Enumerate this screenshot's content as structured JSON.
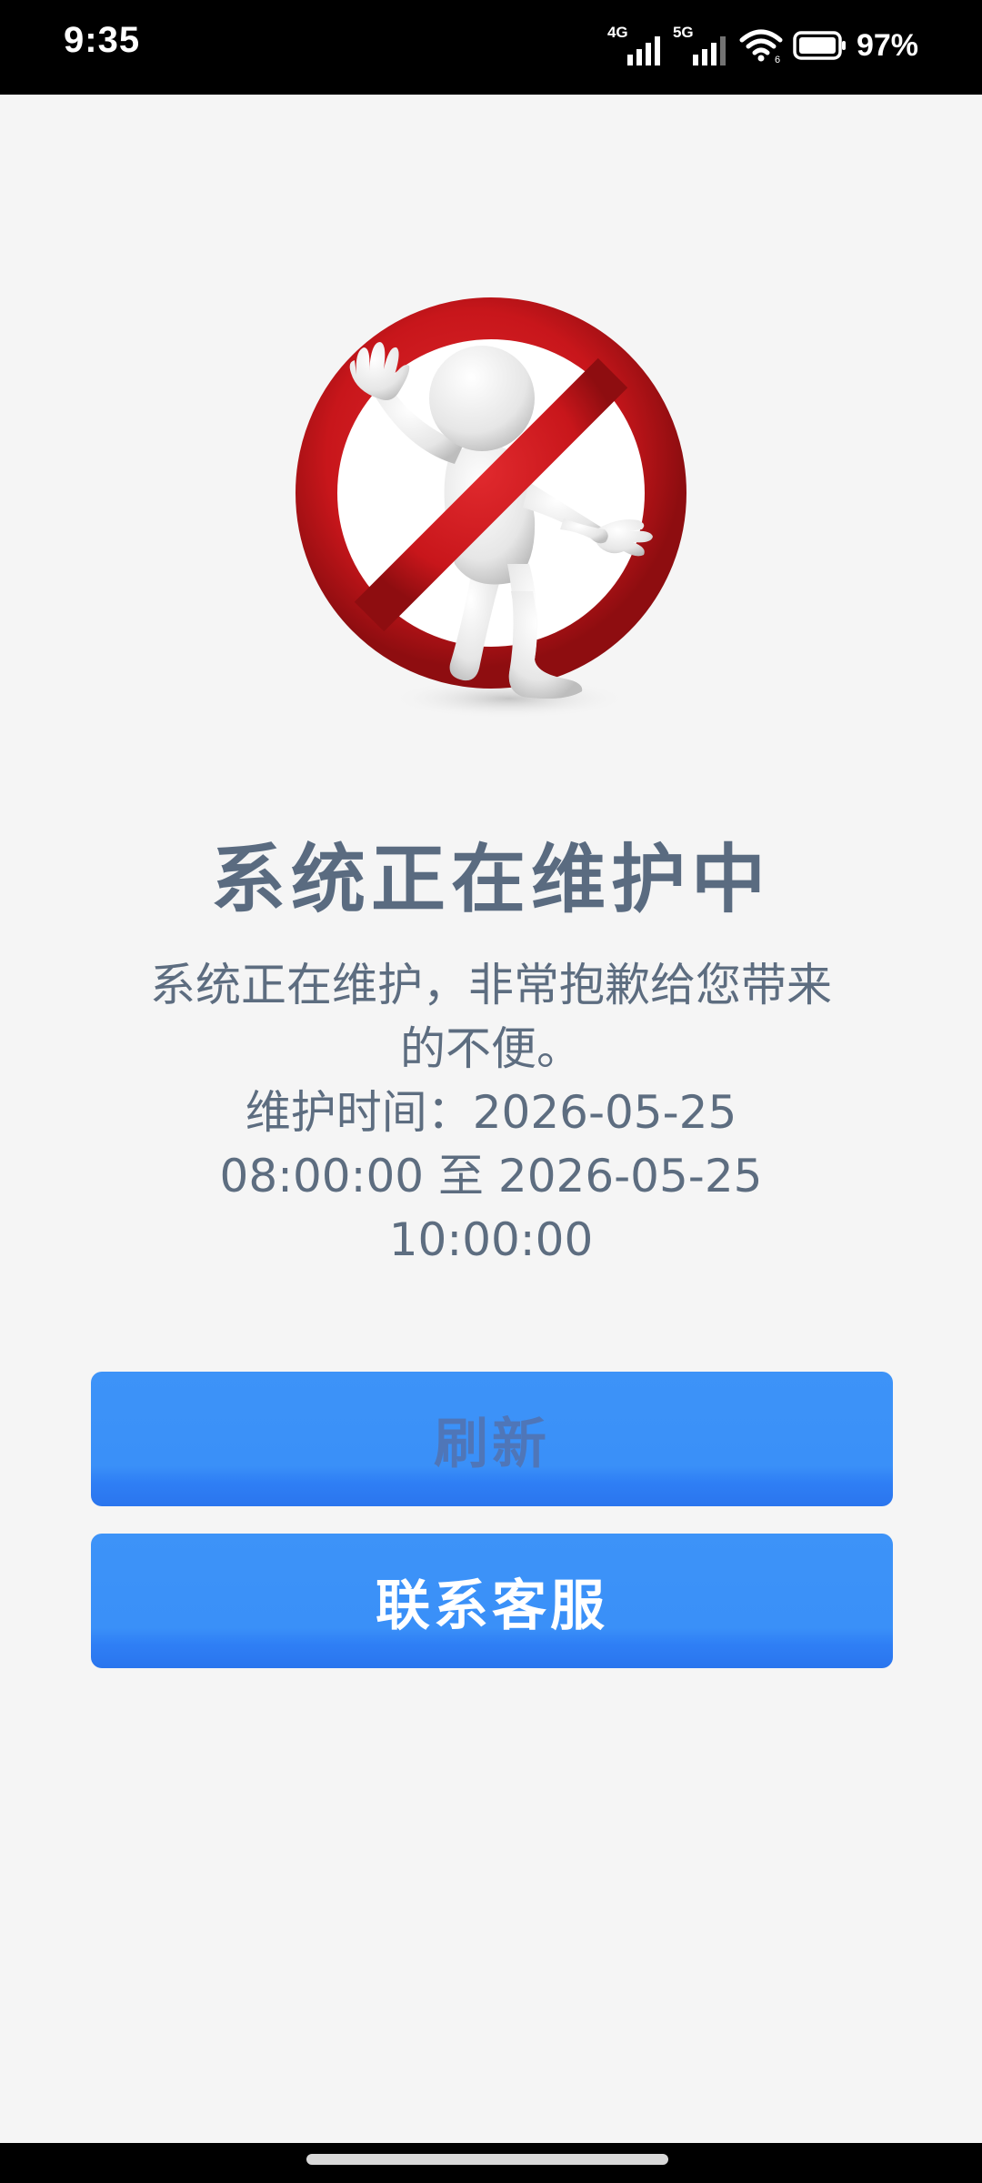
{
  "status_bar": {
    "time": "9:35",
    "network_1": "4G",
    "network_2": "5G",
    "battery": "97%"
  },
  "illustration": {
    "icon": "no-entry-person-icon",
    "colors": {
      "prohibition": "#c8161b",
      "figure": "#ececec"
    }
  },
  "maintenance": {
    "title": "系统正在维护中",
    "message_line_1": "系统正在维护，非常抱歉给您带来的不便。",
    "message_line_2": "维护时间：2026-05-25 08:00:00 至 2026-05-25 10:00:00"
  },
  "buttons": {
    "refresh_label": "刷新",
    "contact_label": "联系客服",
    "color": "#3a90f8"
  }
}
